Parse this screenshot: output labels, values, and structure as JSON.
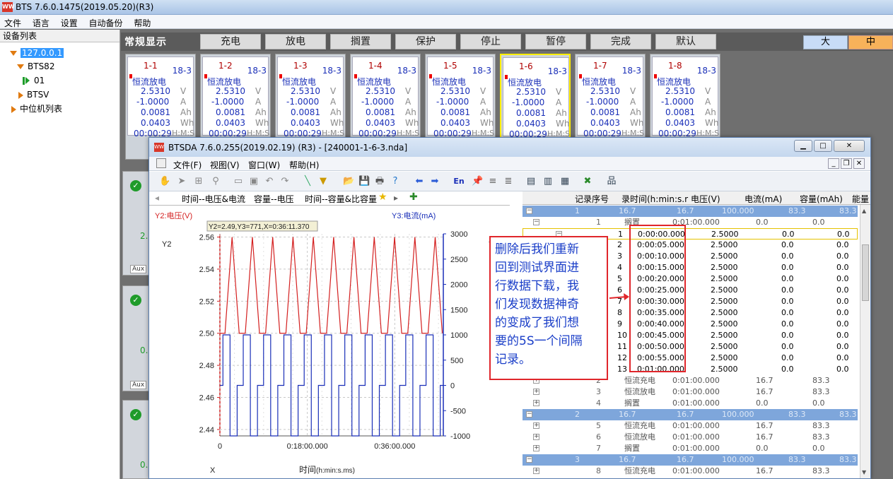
{
  "app": {
    "title": "BTS 7.6.0.1475(2019.05.20)(R3)",
    "icon_text": "WW"
  },
  "menu": [
    "文件",
    "语言",
    "设置",
    "自动备份",
    "帮助"
  ],
  "device_panel": {
    "header": "设备列表",
    "tree": [
      {
        "label": "127.0.0.1",
        "icon": "expanded-triangle-icon",
        "selected": true
      },
      {
        "label": "BTS82",
        "icon": "expanded-triangle-icon"
      },
      {
        "label": "01",
        "icon": "running-icon"
      },
      {
        "label": "BTSV",
        "icon": "collapsed-triangle-icon"
      },
      {
        "label": "中位机列表",
        "icon": "collapsed-triangle-icon"
      }
    ]
  },
  "control_bar": {
    "title": "常规显示",
    "buttons": [
      "充电",
      "放电",
      "搁置",
      "保护",
      "停止",
      "暂停",
      "完成",
      "默认"
    ],
    "size_big": "大",
    "size_mid": "中"
  },
  "channels": [
    {
      "id": "1-1",
      "sub": "18-3",
      "mode": "恒流放电",
      "voltage": "2.5310",
      "current": "-1.0000",
      "capacity": "0.0081",
      "energy": "0.0403",
      "time": "00:00:29"
    },
    {
      "id": "1-2",
      "sub": "18-3",
      "mode": "恒流放电",
      "voltage": "2.5310",
      "current": "-1.0000",
      "capacity": "0.0081",
      "energy": "0.0403",
      "time": "00:00:29"
    },
    {
      "id": "1-3",
      "sub": "18-3",
      "mode": "恒流放电",
      "voltage": "2.5310",
      "current": "-1.0000",
      "capacity": "0.0081",
      "energy": "0.0403",
      "time": "00:00:29"
    },
    {
      "id": "1-4",
      "sub": "18-3",
      "mode": "恒流放电",
      "voltage": "2.5310",
      "current": "-1.0000",
      "capacity": "0.0081",
      "energy": "0.0403",
      "time": "00:00:29"
    },
    {
      "id": "1-5",
      "sub": "18-3",
      "mode": "恒流放电",
      "voltage": "2.5310",
      "current": "-1.0000",
      "capacity": "0.0081",
      "energy": "0.0403",
      "time": "00:00:29"
    },
    {
      "id": "1-6",
      "sub": "18-3",
      "mode": "恒流放电",
      "voltage": "2.5310",
      "current": "-1.0000",
      "capacity": "0.0081",
      "energy": "0.0403",
      "time": "00:00:29"
    },
    {
      "id": "1-7",
      "sub": "18-3",
      "mode": "恒流放电",
      "voltage": "2.5310",
      "current": "-1.0000",
      "capacity": "0.0081",
      "energy": "0.0403",
      "time": "00:00:29"
    },
    {
      "id": "1-8",
      "sub": "18-3",
      "mode": "恒流放电",
      "voltage": "2.5310",
      "current": "-1.0000",
      "capacity": "0.0081",
      "energy": "0.0403",
      "time": "00:00:29"
    }
  ],
  "units": {
    "v": "V",
    "a": "A",
    "ah": "Ah",
    "wh": "Wh",
    "hms": "H:M:S"
  },
  "side_cards": [
    {
      "check": "✓",
      "aux": "Aux",
      "value": "2."
    },
    {
      "check": "✓",
      "aux": "Aux",
      "value": "0."
    },
    {
      "check": "✓",
      "aux": "",
      "value": "0."
    }
  ],
  "window": {
    "title": "BTSDA 7.6.0.255(2019.02.19) (R3) - [240001-1-6-3.nda]",
    "menu": [
      "文件(F)",
      "视图(V)",
      "窗口(W)",
      "帮助(H)"
    ],
    "tabs": [
      "时间--电压&电流",
      "容量--电压",
      "时间--容量&比容量"
    ],
    "toolbar_en": "En"
  },
  "chart_data": {
    "type": "line",
    "title": "",
    "y2_label": "Y2:电压(V)",
    "y3_label": "Y3:电流(mA)",
    "y2_axis_name": "Y2",
    "y3_axis_name": "Y3",
    "x_axis_name": "X",
    "xlabel": "时间",
    "xlabel_unit": "(h:min:s.ms)",
    "readout": "Y2=2.49,Y3=771,X=0:36:11.370",
    "y2_ticks": [
      "2.56",
      "2.54",
      "2.52",
      "2.50",
      "2.48",
      "2.46",
      "2.44"
    ],
    "y3_ticks": [
      "3000",
      "2500",
      "2000",
      "1500",
      "1000",
      "500",
      "0",
      "-500",
      "-1000"
    ],
    "x_ticks": [
      "0",
      "0:18:00.000",
      "0:36:00.000"
    ],
    "ylim_y2": [
      2.436,
      2.562
    ],
    "ylim_y3": [
      -1000,
      3000
    ],
    "xlim_min": [
      0,
      46
    ],
    "grid": true,
    "series": [
      {
        "name": "电压",
        "color": "#d42020",
        "axis": "y2",
        "pattern": "triangle",
        "cycles": 11,
        "low": 2.5,
        "high": 2.56
      },
      {
        "name": "电流",
        "color": "#1a2fb8",
        "axis": "y3",
        "pattern": "square",
        "cycles": 11,
        "low": -1000,
        "high": 1000,
        "mid": 0
      }
    ]
  },
  "table": {
    "headers": [
      "记录序号",
      "录时间(h:min:s.r",
      "电压(V)",
      "电流(mA)",
      "容量(mAh)",
      "能量"
    ],
    "rows": [
      {
        "type": "grp",
        "c": [
          "1",
          "16.7",
          "16.7",
          "100.000",
          "83.3",
          "83.3"
        ],
        "sign": "−"
      },
      {
        "type": "step",
        "c": [
          "1",
          "搁置",
          "0:01:00.000",
          "0.0",
          "0.0"
        ],
        "sign": "−"
      },
      {
        "type": "rec",
        "c": [
          "1",
          "0:00:00.000",
          "2.5000",
          "0.0",
          "0.0"
        ],
        "sign": "−"
      },
      {
        "type": "rec",
        "c": [
          "2",
          "0:00:05.000",
          "2.5000",
          "0.0",
          "0.0"
        ]
      },
      {
        "type": "rec",
        "c": [
          "3",
          "0:00:10.000",
          "2.5000",
          "0.0",
          "0.0"
        ]
      },
      {
        "type": "rec",
        "c": [
          "4",
          "0:00:15.000",
          "2.5000",
          "0.0",
          "0.0"
        ]
      },
      {
        "type": "rec",
        "c": [
          "5",
          "0:00:20.000",
          "2.5000",
          "0.0",
          "0.0"
        ]
      },
      {
        "type": "rec",
        "c": [
          "6",
          "0:00:25.000",
          "2.5000",
          "0.0",
          "0.0"
        ]
      },
      {
        "type": "rec",
        "c": [
          "7",
          "0:00:30.000",
          "2.5000",
          "0.0",
          "0.0"
        ]
      },
      {
        "type": "rec",
        "c": [
          "8",
          "0:00:35.000",
          "2.5000",
          "0.0",
          "0.0"
        ]
      },
      {
        "type": "rec",
        "c": [
          "9",
          "0:00:40.000",
          "2.5000",
          "0.0",
          "0.0"
        ]
      },
      {
        "type": "rec",
        "c": [
          "10",
          "0:00:45.000",
          "2.5000",
          "0.0",
          "0.0"
        ]
      },
      {
        "type": "rec",
        "c": [
          "11",
          "0:00:50.000",
          "2.5000",
          "0.0",
          "0.0"
        ]
      },
      {
        "type": "rec",
        "c": [
          "12",
          "0:00:55.000",
          "2.5000",
          "0.0",
          "0.0"
        ]
      },
      {
        "type": "rec",
        "c": [
          "13",
          "0:01:00.000",
          "2.5000",
          "0.0",
          "0.0"
        ]
      },
      {
        "type": "step",
        "c": [
          "2",
          "恒流充电",
          "0:01:00.000",
          "16.7",
          "83.3"
        ],
        "sign": "+"
      },
      {
        "type": "step",
        "c": [
          "3",
          "恒流放电",
          "0:01:00.000",
          "16.7",
          "83.3"
        ],
        "sign": "+"
      },
      {
        "type": "step",
        "c": [
          "4",
          "搁置",
          "0:01:00.000",
          "0.0",
          "0.0"
        ],
        "sign": "+"
      },
      {
        "type": "grp",
        "c": [
          "2",
          "16.7",
          "16.7",
          "100.000",
          "83.3",
          "83.3"
        ],
        "sign": "−"
      },
      {
        "type": "step",
        "c": [
          "5",
          "恒流充电",
          "0:01:00.000",
          "16.7",
          "83.3"
        ],
        "sign": "+"
      },
      {
        "type": "step",
        "c": [
          "6",
          "恒流放电",
          "0:01:00.000",
          "16.7",
          "83.3"
        ],
        "sign": "+"
      },
      {
        "type": "step",
        "c": [
          "7",
          "搁置",
          "0:01:00.000",
          "0.0",
          "0.0"
        ],
        "sign": "+"
      },
      {
        "type": "grp",
        "c": [
          "3",
          "16.7",
          "16.7",
          "100.000",
          "83.3",
          "83.3"
        ],
        "sign": "−"
      },
      {
        "type": "step",
        "c": [
          "8",
          "恒流充电",
          "0:01:00.000",
          "16.7",
          "83.3"
        ],
        "sign": "+"
      }
    ]
  },
  "annotation": {
    "lines": [
      "删除后我们重新",
      "回到测试界面进",
      "行数据下载，我",
      "们发现数据神奇",
      "的变成了我们想",
      "要的5S一个间隔",
      "记录。"
    ]
  }
}
